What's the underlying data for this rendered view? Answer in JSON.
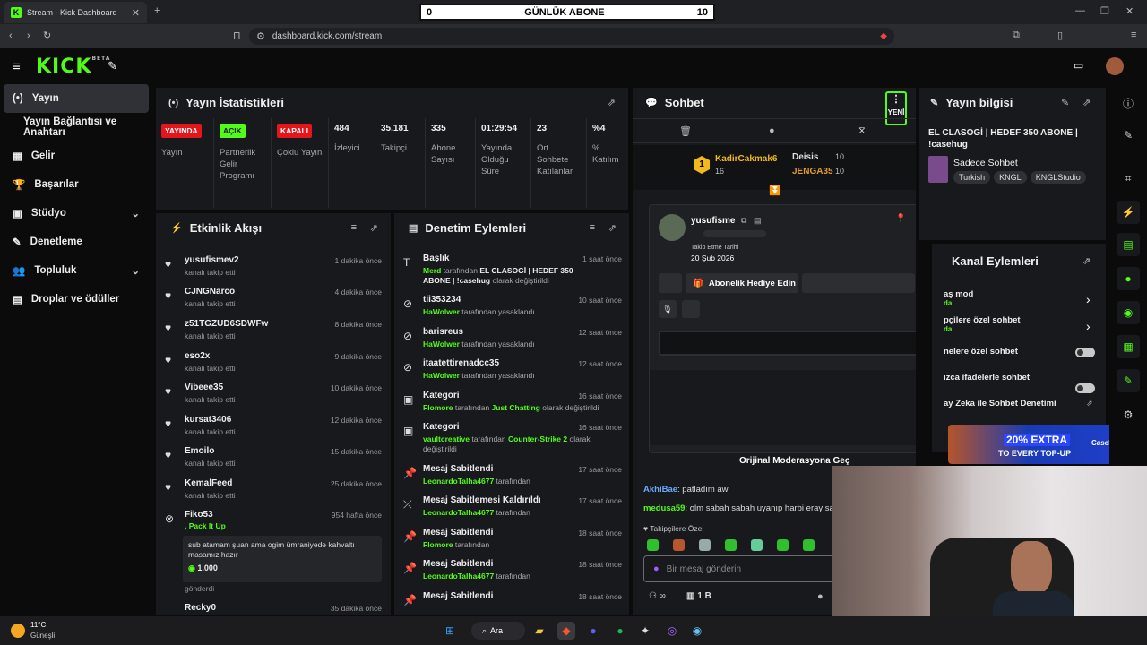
{
  "browser": {
    "tab_title": "Stream - Kick Dashboard",
    "url": "dashboard.kick.com/stream"
  },
  "overlay": {
    "left": "0",
    "title": "GÜNLÜK ABONE",
    "right": "10"
  },
  "sidebar": {
    "items": [
      {
        "label": "Yayın"
      },
      {
        "label": "Yayın Bağlantısı ve Anahtarı"
      },
      {
        "label": "Gelir"
      },
      {
        "label": "Başarılar"
      },
      {
        "label": "Stüdyo"
      },
      {
        "label": "Denetleme"
      },
      {
        "label": "Topluluk"
      },
      {
        "label": "Droplar ve ödüller"
      }
    ]
  },
  "stats": {
    "title": "Yayın İstatistikleri",
    "cols": [
      {
        "value": "YAYINDA",
        "label": "Yayın"
      },
      {
        "value": "AÇIK",
        "label": "Partnerlik Gelir Programı"
      },
      {
        "value": "KAPALI",
        "label": "Çoklu Yayın"
      },
      {
        "value": "484",
        "label": "İzleyici"
      },
      {
        "value": "35.181",
        "label": "Takipçi"
      },
      {
        "value": "335",
        "label": "Abone Sayısı"
      },
      {
        "value": "01:29:54",
        "label": "Yayında Olduğu Süre"
      },
      {
        "value": "23",
        "label": "Ort. Sohbete Katılanlar"
      },
      {
        "value": "%4",
        "label": "% Katılım"
      }
    ]
  },
  "feed": {
    "title": "Etkinlik Akışı",
    "rows": [
      {
        "name": "yusufismev2",
        "sub": "kanalı takip etti",
        "time": "1 dakika önce"
      },
      {
        "name": "CJNGNarco",
        "sub": "kanalı takip etti",
        "time": "4 dakika önce"
      },
      {
        "name": "z51TGZUD6SDWFw",
        "sub": "kanalı takip etti",
        "time": "8 dakika önce"
      },
      {
        "name": "eso2x",
        "sub": "kanalı takip etti",
        "time": "9 dakika önce"
      },
      {
        "name": "Vibeee35",
        "sub": "kanalı takip etti",
        "time": "10 dakika önce"
      },
      {
        "name": "kursat3406",
        "sub": "kanalı takip etti",
        "time": "12 dakika önce"
      },
      {
        "name": "Emoilo",
        "sub": "kanalı takip etti",
        "time": "15 dakika önce"
      },
      {
        "name": "KemalFeed",
        "sub": "kanalı takip etti",
        "time": "25 dakika önce"
      }
    ],
    "special": {
      "name": "Fiko53",
      "action": ", Pack It Up",
      "time": "954 hafta önce",
      "message": "sub atamam şuan ama ogim ümraniyede kahvaltı masamız hazır",
      "amount": "1.000",
      "sub": "gönderdi"
    },
    "last": {
      "name": "Recky0",
      "time": "35 dakika önce"
    }
  },
  "mod": {
    "title": "Denetim Eylemleri",
    "rows": [
      {
        "title": "Başlık",
        "user": "Merd",
        "mid": " tarafından ",
        "bold": "EL CLASOGİ | HEDEF 350 ABONE | !casehug",
        "end": " olarak değiştirildi",
        "time": "1 saat önce"
      },
      {
        "title": "tii353234",
        "user": "HaWolwer",
        "mid": " tarafından yasaklandı",
        "bold": "",
        "end": "",
        "time": "10 saat önce"
      },
      {
        "title": "barisreus",
        "user": "HaWolwer",
        "mid": " tarafından yasaklandı",
        "bold": "",
        "end": "",
        "time": "12 saat önce"
      },
      {
        "title": "itaatettirenadcc35",
        "user": "HaWolwer",
        "mid": " tarafından yasaklandı",
        "bold": "",
        "end": "",
        "time": "12 saat önce"
      },
      {
        "title": "Kategori",
        "user": "Flomore",
        "mid": " tarafından ",
        "bold": "Just Chatting",
        "end": " olarak değiştirildi",
        "time": "16 saat önce"
      },
      {
        "title": "Kategori",
        "user": "vaultcreative",
        "mid": " tarafından ",
        "bold": "Counter-Strike 2",
        "end": " olarak değiştirildi",
        "time": "16 saat önce"
      },
      {
        "title": "Mesaj Sabitlendi",
        "user": "LeonardoTalha4677",
        "mid": " tarafından",
        "bold": "",
        "end": "",
        "time": "17 saat önce"
      },
      {
        "title": "Mesaj Sabitlemesi Kaldırıldı",
        "user": "LeonardoTalha4677",
        "mid": " tarafından",
        "bold": "",
        "end": "",
        "time": "17 saat önce"
      },
      {
        "title": "Mesaj Sabitlendi",
        "user": "Flomore",
        "mid": " tarafından",
        "bold": "",
        "end": "",
        "time": "18 saat önce"
      },
      {
        "title": "Mesaj Sabitlendi",
        "user": "LeonardoTalha4677",
        "mid": " tarafından",
        "bold": "",
        "end": "",
        "time": "18 saat önce"
      },
      {
        "title": "Mesaj Sabitlendi",
        "user": "LeonardoTalha4677",
        "mid": " tarafından",
        "bold": "",
        "end": "",
        "time": "18 saat önce"
      }
    ]
  },
  "chat": {
    "title": "Sohbet",
    "new_label": "YENİ",
    "leaders": [
      {
        "name": "KadirCakmak6",
        "count": "16"
      },
      {
        "name": "Deisis",
        "count": "10"
      },
      {
        "name": "JENGA35",
        "count": "10"
      }
    ],
    "rank": "1",
    "card": {
      "user": "yusufisme",
      "follow_label": "Takip Etme Tarihi",
      "follow_date": "20 Şub 2026",
      "gift_label": "Abonelik Hediye Edin"
    },
    "moderation_btn": "Orijinal Moderasyona Geç",
    "messages": [
      {
        "user": "AkhiBae",
        "text": ": patladım aw"
      },
      {
        "user": "medusa59",
        "text": ": olm sabah sabah uyanıp harbi eray san"
      }
    ],
    "followers_only": "Takipçilere Özel",
    "input_placeholder": "Bir mesaj gönderin",
    "footer_count": "1 B"
  },
  "info": {
    "title": "Yayın bilgisi",
    "stream_title": "EL CLASOGİ | HEDEF 350 ABONE | !casehug",
    "category": "Sadece Sohbet",
    "tags": [
      "Turkish",
      "KNGL",
      "KNGLStudio"
    ]
  },
  "actions": {
    "title": "Kanal Eylemleri",
    "rows": [
      {
        "label": "aş mod",
        "sub": "da"
      },
      {
        "label": "pçilere özel sohbet",
        "sub": "da"
      },
      {
        "label": "nelere özel sohbet",
        "sub": ""
      },
      {
        "label": "ızca ifadelerle sohbet",
        "sub": ""
      },
      {
        "label": "ay Zeka ile Sohbet Denetimi",
        "sub": ""
      }
    ]
  },
  "ad": {
    "text1": "20% EXTRA",
    "text2": "TO EVERY TOP-UP",
    "brand": "CaseHug"
  },
  "taskbar": {
    "temp": "11°C",
    "weather": "Güneşli",
    "search": "Ara"
  },
  "colors": {
    "accent": "#53fc18",
    "live": "#e5161b"
  }
}
